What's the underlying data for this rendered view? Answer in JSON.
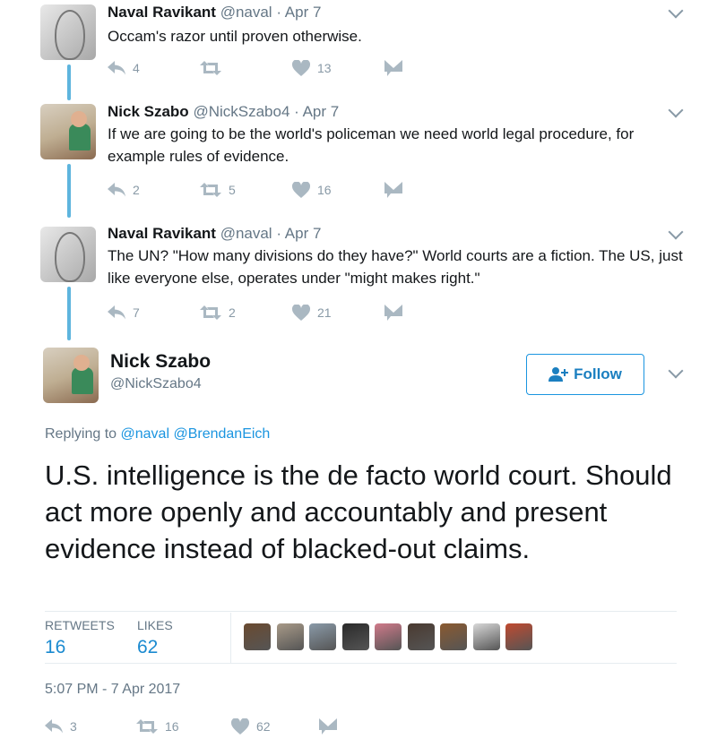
{
  "thread": [
    {
      "name": "Naval Ravikant",
      "handle": "@naval",
      "date": "· Apr 7",
      "text": "Occam's razor until proven otherwise.",
      "replies": "4",
      "retweets": "",
      "likes": "13"
    },
    {
      "name": "Nick Szabo",
      "handle": "@NickSzabo4",
      "date": "· Apr 7",
      "text": "If we are going to be the world's policeman we need world legal procedure, for example rules of evidence.",
      "replies": "2",
      "retweets": "5",
      "likes": "16"
    },
    {
      "name": "Naval Ravikant",
      "handle": "@naval",
      "date": "· Apr 7",
      "text": "The UN? \"How many divisions do they have?\" World courts are a fiction. The US, just like everyone else, operates under \"might makes right.\"",
      "replies": "7",
      "retweets": "2",
      "likes": "21"
    }
  ],
  "main": {
    "name": "Nick Szabo",
    "handle": "@NickSzabo4",
    "follow_label": "Follow",
    "replying_prefix": "Replying to",
    "replying_to": [
      "@naval",
      "@BrendanEich"
    ],
    "text": "U.S. intelligence is the de facto world court. Should act more openly and accountably and present evidence instead of blacked-out claims.",
    "retweets_label": "RETWEETS",
    "retweets": "16",
    "likes_label": "LIKES",
    "likes": "62",
    "timestamp": "5:07 PM - 7 Apr 2017",
    "replies_count": "3",
    "retweets_count": "16",
    "likes_count": "62",
    "liker_colors": [
      "#6a4a30",
      "#a89a88",
      "#8a9aa8",
      "#2a2a2a",
      "#d07a8a",
      "#4a3a30",
      "#8a5a30",
      "#d8d8d8",
      "#c04a30"
    ]
  },
  "colors": {
    "accent": "#1b95e0",
    "thread_line": "#5eb5de",
    "icon": "#aab8c2"
  }
}
